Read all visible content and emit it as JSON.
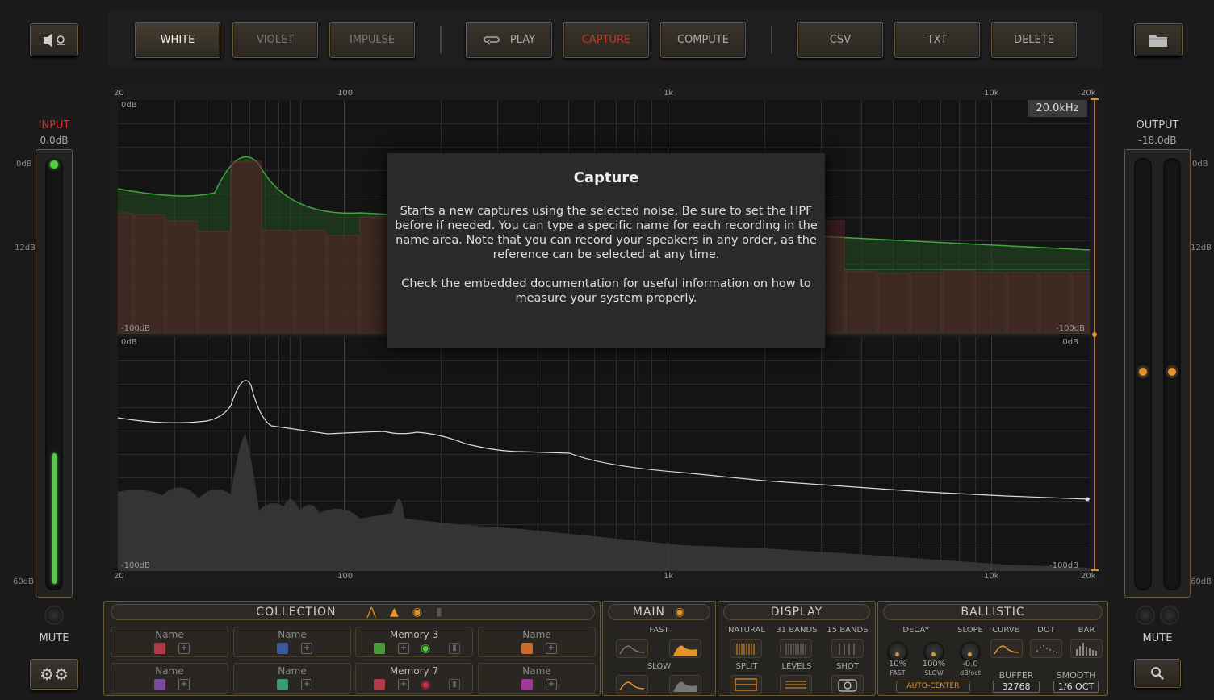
{
  "toolbar": {
    "noise": [
      "WHITE",
      "VIOLET",
      "IMPULSE"
    ],
    "play": "PLAY",
    "capture": "CAPTURE",
    "compute": "COMPUTE",
    "export": [
      "CSV",
      "TXT",
      "DELETE"
    ]
  },
  "input": {
    "label": "INPUT",
    "value": "0.0dB",
    "mute": "MUTE",
    "level": 0.4
  },
  "output": {
    "label": "OUTPUT",
    "value": "-18.0dB",
    "mute": "MUTE"
  },
  "meter_scale": [
    "0dB",
    "12dB",
    "60dB"
  ],
  "plot": {
    "x_ticks": [
      "20",
      "100",
      "1k",
      "10k",
      "20k"
    ],
    "y_top": "0dB",
    "y_bottom": "-100dB",
    "freq_readout": "20.0kHz"
  },
  "dialog": {
    "title": "Capture",
    "p1": "Starts a new captures using the selected noise. Be sure to set the HPF before if needed. You can type a specific name for each recording in the name area. Note that you can record your speakers in any order, as the reference can be selected at any time.",
    "p2": "Check the embedded documentation for useful information on how to measure your system properly."
  },
  "collection": {
    "title": "COLLECTION",
    "slots": [
      {
        "name": "Name",
        "color": "#b03a48"
      },
      {
        "name": "Name",
        "color": "#3a5a9a"
      },
      {
        "name": "Memory 3",
        "color": "#4a9a3a"
      },
      {
        "name": "Name",
        "color": "#c86a2a"
      },
      {
        "name": "Name",
        "color": "#7a4a9a"
      },
      {
        "name": "Name",
        "color": "#3a9a6a"
      },
      {
        "name": "Memory 7",
        "color": "#b03a48"
      },
      {
        "name": "Name",
        "color": "#a0389a"
      }
    ]
  },
  "main": {
    "title": "MAIN",
    "fast": "FAST",
    "slow": "SLOW"
  },
  "display": {
    "title": "DISPLAY",
    "natural": "NATURAL",
    "bands31": "31 BANDS",
    "bands15": "15 BANDS",
    "split": "SPLIT",
    "levels": "LEVELS",
    "shot": "SHOT"
  },
  "ballistic": {
    "title": "BALLISTIC",
    "decay": "DECAY",
    "slope": "SLOPE",
    "curve": "CURVE",
    "dot": "DOT",
    "bar": "BAR",
    "decay_fast_val": "10%",
    "decay_fast": "FAST",
    "decay_slow_val": "100%",
    "decay_slow": "SLOW",
    "slope_val": "-0.0",
    "slope_unit": "dB/oct",
    "autocenter": "AUTO-CENTER",
    "buffer": "BUFFER",
    "buffer_val": "32768",
    "smooth": "SMOOTH",
    "smooth_val": "1/6 OCT"
  },
  "colors": {
    "accent": "#e6922a",
    "frame": "#6b5a3a",
    "input_red": "#d03030",
    "meter_green": "#4cd13c"
  }
}
